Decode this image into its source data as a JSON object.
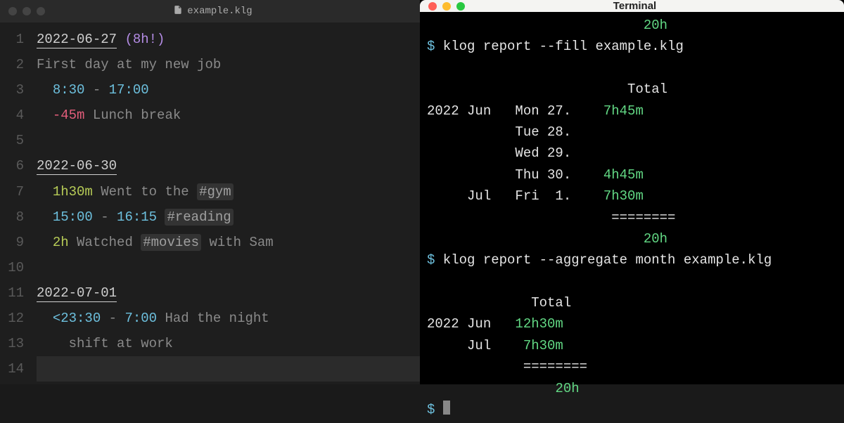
{
  "editor": {
    "filename": "example.klg",
    "lines": [
      {
        "n": "1",
        "date": "2022-06-27",
        "should": "(8h!)"
      },
      {
        "n": "2",
        "comment": "First day at my new job"
      },
      {
        "n": "3",
        "indent": "  ",
        "t1": "8:30",
        "dash": " - ",
        "t2": "17:00"
      },
      {
        "n": "4",
        "indent": "  ",
        "neg": "-45m",
        "rest": " Lunch break"
      },
      {
        "n": "5",
        "blank": true
      },
      {
        "n": "6",
        "date": "2022-06-30"
      },
      {
        "n": "7",
        "indent": "  ",
        "dur": "1h30m",
        "before": " Went to the ",
        "tag": "#gym"
      },
      {
        "n": "8",
        "indent": "  ",
        "t1": "15:00",
        "dash": " - ",
        "t2": "16:15",
        "sp": " ",
        "tag": "#reading"
      },
      {
        "n": "9",
        "indent": "  ",
        "dur": "2h",
        "before": " Watched ",
        "tag": "#movies",
        "after": " with Sam"
      },
      {
        "n": "10",
        "blank": true
      },
      {
        "n": "11",
        "date": "2022-07-01"
      },
      {
        "n": "12",
        "indent": "  ",
        "t1": "<23:30",
        "dash": " - ",
        "t2": "7:00",
        "rest": " Had the night"
      },
      {
        "n": "13",
        "indent": "    ",
        "rest": "shift at work"
      },
      {
        "n": "14",
        "blank": true,
        "active": true
      }
    ]
  },
  "terminal": {
    "title": "Terminal",
    "prompt": "$",
    "sum20": "20h",
    "cmd1": "klog report --fill example.klg",
    "cmd2": "klog report --aggregate month example.klg",
    "totalLabel": "Total",
    "divider": "========",
    "report1": {
      "year": "2022",
      "rows": [
        {
          "month": "Jun",
          "day": "Mon 27.",
          "total": "7h45m"
        },
        {
          "month": "",
          "day": "Tue 28.",
          "total": ""
        },
        {
          "month": "",
          "day": "Wed 29.",
          "total": ""
        },
        {
          "month": "",
          "day": "Thu 30.",
          "total": "4h45m"
        },
        {
          "month": "Jul",
          "day": "Fri  1.",
          "total": "7h30m"
        }
      ]
    },
    "report2": {
      "year": "2022",
      "rows": [
        {
          "month": "Jun",
          "total": "12h30m"
        },
        {
          "month": "Jul",
          "total": " 7h30m"
        }
      ]
    }
  }
}
